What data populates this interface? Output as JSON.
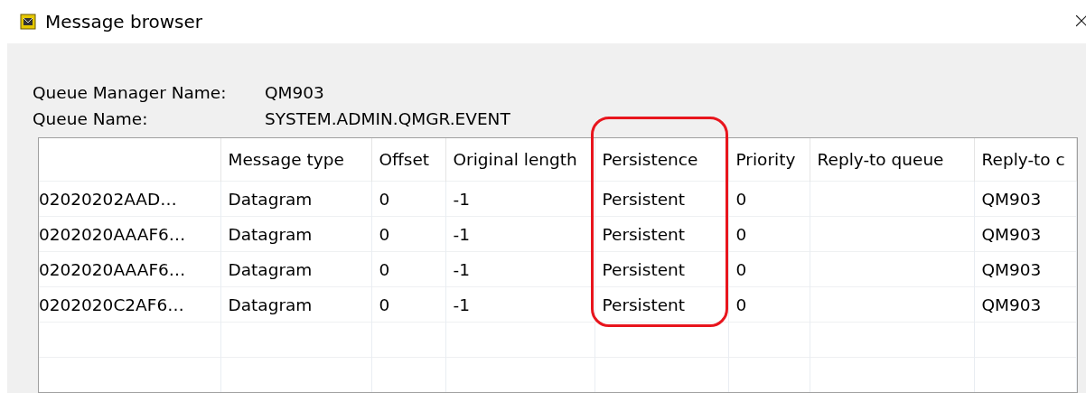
{
  "window": {
    "title": "Message browser"
  },
  "fields": [
    {
      "label": "Queue Manager Name:",
      "value": "QM903"
    },
    {
      "label": "Queue Name:",
      "value": "SYSTEM.ADMIN.QMGR.EVENT"
    }
  ],
  "table": {
    "columns": [
      {
        "highlighted": false
      },
      {
        "label": "Message type",
        "highlighted": false
      },
      {
        "label": "Offset",
        "highlighted": false
      },
      {
        "label": "Original length",
        "highlighted": false
      },
      {
        "label": "Persistence",
        "highlighted": true
      },
      {
        "label": "Priority",
        "highlighted": false
      },
      {
        "label": "Reply-to queue",
        "highlighted": false
      },
      {
        "label": "Reply-to c",
        "highlighted": false
      }
    ],
    "rows": [
      [
        "02020202AAD…",
        "Datagram",
        "0",
        "-1",
        "Persistent",
        "0",
        "",
        "QM903"
      ],
      [
        "0202020AAAF6…",
        "Datagram",
        "0",
        "-1",
        "Persistent",
        "0",
        "",
        "QM903"
      ],
      [
        "0202020AAAF6…",
        "Datagram",
        "0",
        "-1",
        "Persistent",
        "0",
        "",
        "QM903"
      ],
      [
        "0202020C2AF6…",
        "Datagram",
        "0",
        "-1",
        "Persistent",
        "0",
        "",
        "QM903"
      ]
    ]
  }
}
